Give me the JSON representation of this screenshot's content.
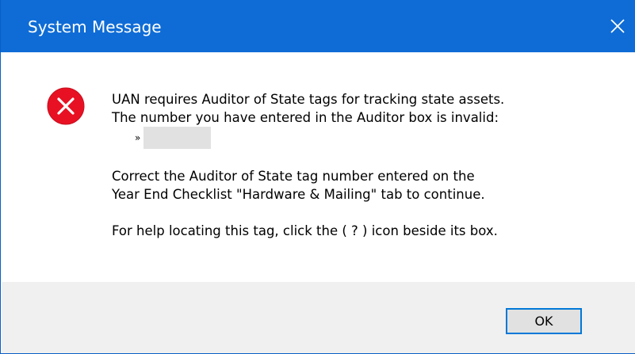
{
  "window": {
    "title": "System Message",
    "close_icon": "close-icon"
  },
  "message": {
    "icon": "error-icon",
    "line1": "UAN requires Auditor of State tags for tracking state assets.",
    "line2": "The number you have entered in the Auditor box is invalid:",
    "bullet": "»",
    "line3": "Correct the Auditor of State tag number entered on the",
    "line4": "Year End Checklist \"Hardware & Mailing\" tab to continue.",
    "line5": "For help locating this tag, click the ( ? ) icon beside its box."
  },
  "buttons": {
    "ok_label": "OK"
  },
  "colors": {
    "titlebar": "#0f6cd6",
    "error_red": "#e81123",
    "button_border": "#0078d7",
    "footer_bg": "#f0f0f0"
  }
}
